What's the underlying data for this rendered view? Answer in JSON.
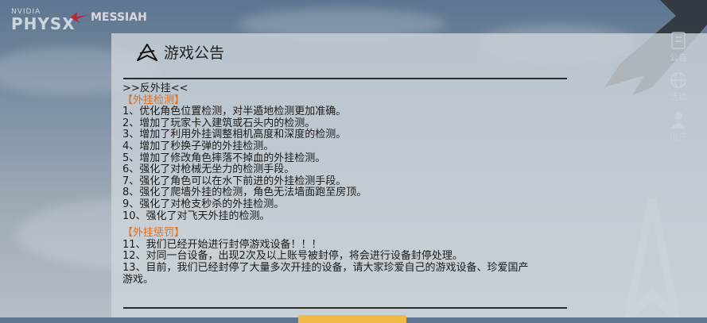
{
  "logos": {
    "physx_top": "NVIDIA",
    "physx_main": "PHYSX",
    "messiah": "MESSIAH"
  },
  "side_menu": [
    {
      "label": "公告",
      "icon": "notice-icon"
    },
    {
      "label": "活动",
      "icon": "globe-icon"
    },
    {
      "label": "用户",
      "icon": "user-icon"
    }
  ],
  "notice": {
    "title": "游戏公告",
    "heading": ">>反外挂<<",
    "section1_title": "【外挂检测】",
    "section1_items": [
      "1、优化角色位置检测，对半遁地检测更加准确。",
      "2、增加了玩家卡入建筑或石头内的检测。",
      "3、增加了利用外挂调整相机高度和深度的检测。",
      "4、增加了秒换子弹的外挂检测。",
      "5、增加了修改角色摔落不掉血的外挂检测。",
      "6、强化了对枪械无坐力的检测手段。",
      "7、强化了角色可以在水下前进的外挂检测手段。",
      "8、强化了爬墙外挂的检测，角色无法墙面跑至房顶。",
      "9、强化了对枪支秒杀的外挂检测。",
      "10、强化了对飞天外挂的检测。"
    ],
    "section2_title": "【外挂惩罚】",
    "section2_items": [
      "11、我们已经开始进行封停游戏设备！！！",
      "12、对同一台设备，出现2次及以上账号被封停，将会进行设备封停处理。",
      "13、目前，我们已经封停了大量多次开挂的设备，请大家珍爱自己的游戏设备、珍爱国产",
      "游戏。"
    ]
  },
  "colors": {
    "section_title": "#e46c12",
    "confirm_button": "#f0b845"
  }
}
